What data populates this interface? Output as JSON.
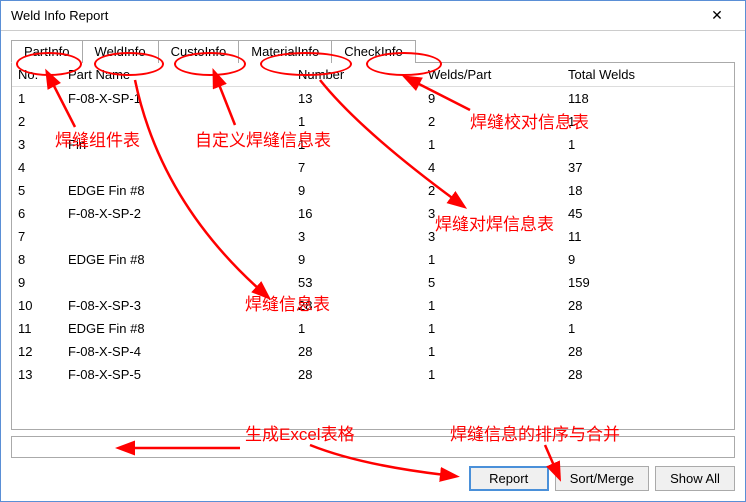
{
  "window": {
    "title": "Weld Info Report"
  },
  "tabs": [
    {
      "label": "PartInfo",
      "active": true
    },
    {
      "label": "WeldInfo",
      "active": false
    },
    {
      "label": "CustoInfo",
      "active": false
    },
    {
      "label": "MaterialInfo",
      "active": false
    },
    {
      "label": "CheckInfo",
      "active": false
    }
  ],
  "columns": {
    "no": "No.",
    "part_name": "Part Name",
    "number": "Number",
    "welds_part": "Welds/Part",
    "total_welds": "Total Welds"
  },
  "rows": [
    {
      "no": "1",
      "part": "F-08-X-SP-1",
      "number": "13",
      "welds": "9",
      "total": "118"
    },
    {
      "no": "2",
      "part": "",
      "number": "1",
      "welds": "2",
      "total": "1"
    },
    {
      "no": "3",
      "part": "Fin",
      "number": "1",
      "welds": "1",
      "total": "1"
    },
    {
      "no": "4",
      "part": "",
      "number": "7",
      "welds": "4",
      "total": "37"
    },
    {
      "no": "5",
      "part": "EDGE Fin #8",
      "number": "9",
      "welds": "2",
      "total": "18"
    },
    {
      "no": "6",
      "part": "F-08-X-SP-2",
      "number": "16",
      "welds": "3",
      "total": "45"
    },
    {
      "no": "7",
      "part": "",
      "number": "3",
      "welds": "3",
      "total": "11"
    },
    {
      "no": "8",
      "part": "EDGE Fin #8",
      "number": "9",
      "welds": "1",
      "total": "9"
    },
    {
      "no": "9",
      "part": "",
      "number": "53",
      "welds": "5",
      "total": "159"
    },
    {
      "no": "10",
      "part": "F-08-X-SP-3",
      "number": "28",
      "welds": "1",
      "total": "28"
    },
    {
      "no": "11",
      "part": "EDGE Fin #8",
      "number": "1",
      "welds": "1",
      "total": "1"
    },
    {
      "no": "12",
      "part": "F-08-X-SP-4",
      "number": "28",
      "welds": "1",
      "total": "28"
    },
    {
      "no": "13",
      "part": "F-08-X-SP-5",
      "number": "28",
      "welds": "1",
      "total": "28"
    }
  ],
  "buttons": {
    "report": "Report",
    "sort_merge": "Sort/Merge",
    "show_all": "Show All"
  },
  "annotations": {
    "a1": "焊缝组件表",
    "a2": "自定义焊缝信息表",
    "a3": "焊缝校对信息表",
    "a4": "焊缝对焊信息表",
    "a5": "焊缝信息表",
    "a6": "生成Excel表格",
    "a7": "焊缝信息的排序与合并"
  }
}
